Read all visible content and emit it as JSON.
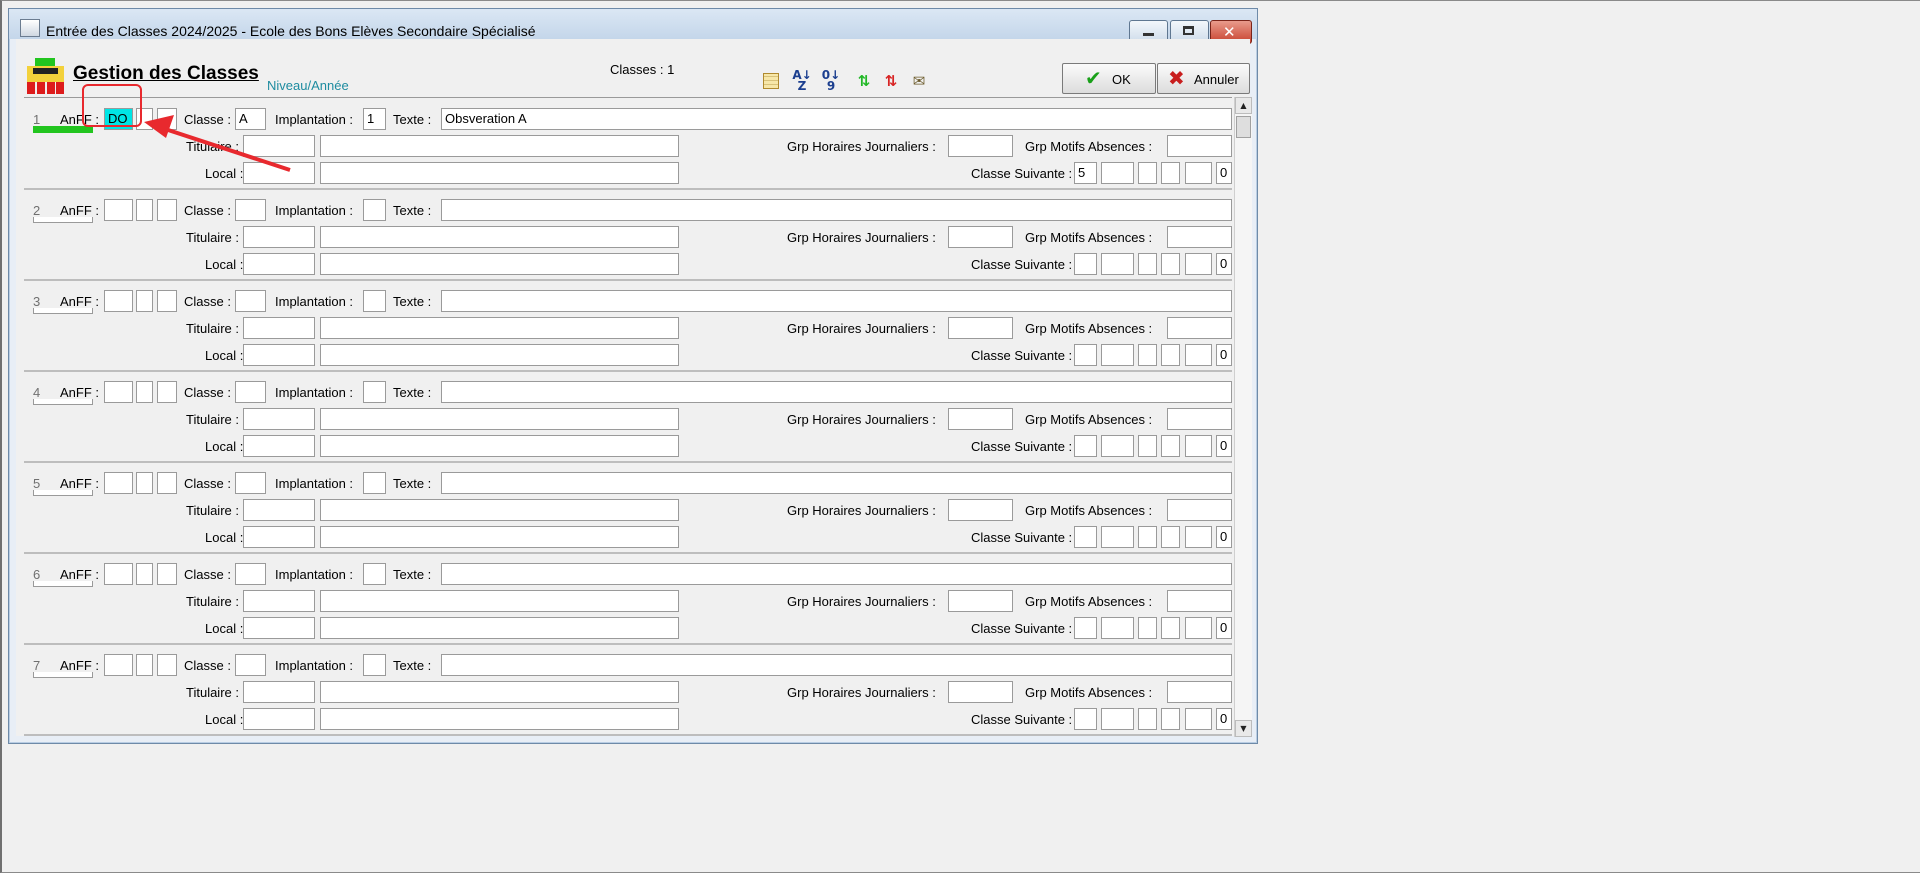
{
  "window": {
    "title": "Entrée des Classes 2024/2025  -  Ecole des Bons Elèves Secondaire Spécialisé"
  },
  "header": {
    "title": "Gestion des Classes",
    "subtitle": "Niveau/Année",
    "count": "Classes : 1"
  },
  "buttons": {
    "ok": "OK",
    "cancel": "Annuler"
  },
  "labels": {
    "anff": "AnFF :",
    "classe": "Classe :",
    "implantation": "Implantation :",
    "texte": "Texte :",
    "titulaire": "Titulaire :",
    "local": "Local :",
    "grp_horaires": "Grp Horaires Journaliers :",
    "grp_motifs": "Grp Motifs Absences :",
    "classe_suivante": "Classe Suivante :"
  },
  "rows": [
    {
      "num": "1",
      "anff": "DO",
      "classe": "A",
      "implantation": "1",
      "texte": "Obsveration A",
      "suivante": "5",
      "suivante_last": "0"
    },
    {
      "num": "2",
      "anff": "",
      "classe": "",
      "implantation": "",
      "texte": "",
      "suivante": "",
      "suivante_last": "0"
    },
    {
      "num": "3",
      "anff": "",
      "classe": "",
      "implantation": "",
      "texte": "",
      "suivante": "",
      "suivante_last": "0"
    },
    {
      "num": "4",
      "anff": "",
      "classe": "",
      "implantation": "",
      "texte": "",
      "suivante": "",
      "suivante_last": "0"
    },
    {
      "num": "5",
      "anff": "",
      "classe": "",
      "implantation": "",
      "texte": "",
      "suivante": "",
      "suivante_last": "0"
    },
    {
      "num": "6",
      "anff": "",
      "classe": "",
      "implantation": "",
      "texte": "",
      "suivante": "",
      "suivante_last": "0"
    },
    {
      "num": "7",
      "anff": "",
      "classe": "",
      "implantation": "",
      "texte": "",
      "suivante": "",
      "suivante_last": "0"
    }
  ],
  "colors": {
    "highlight": "#00e5e5",
    "annotation": "#e8292e",
    "selected_bar": "#22c51f"
  },
  "icons": [
    "window-app-icon",
    "school-logo-icon",
    "grid-icon",
    "sort-az-icon",
    "sort-09-icon",
    "move-up-icon",
    "move-down-icon",
    "bag-icon",
    "check-icon",
    "cross-icon"
  ]
}
